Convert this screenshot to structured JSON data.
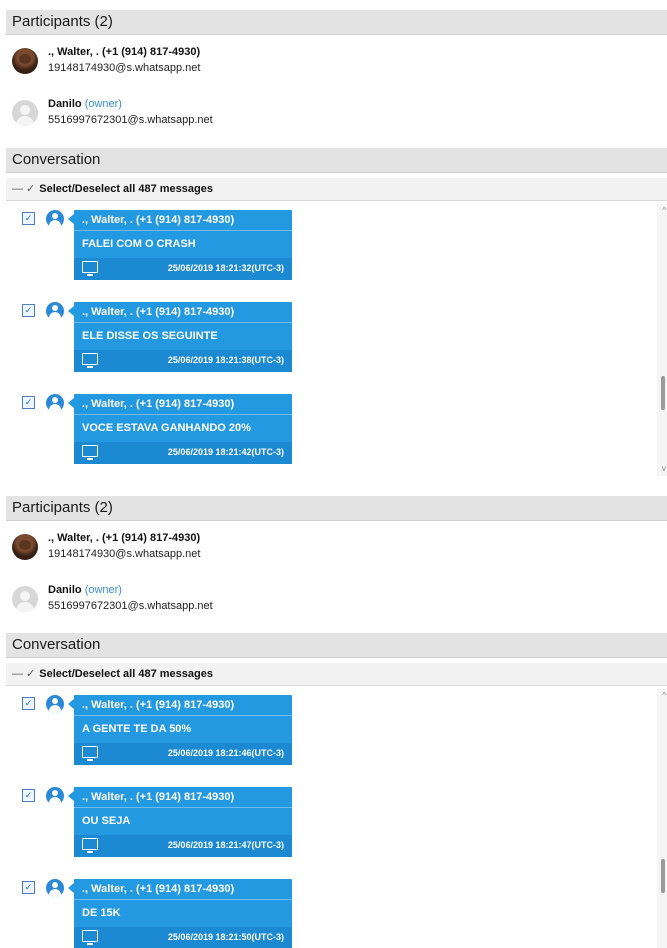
{
  "panels": [
    {
      "participants_header": "Participants (2)",
      "participants": [
        {
          "name": "., Walter, . (+1 (914) 817-4930)",
          "jid": "19148174930@s.whatsapp.net",
          "avatar_icon": "contact-photo"
        },
        {
          "name": "Danilo",
          "role": "(owner)",
          "jid": "5516997672301@s.whatsapp.net",
          "avatar_icon": "default-user-icon"
        }
      ],
      "conversation_header": "Conversation",
      "select_icons": "— ✓",
      "select_all_label": "Select/Deselect all 487 messages",
      "messages": [
        {
          "checked": "✓",
          "sender": "., Walter, . (+1 (914) 817-4930)",
          "text": "FALEI COM O CRASH",
          "timestamp": "25/06/2019 18:21:32(UTC-3)"
        },
        {
          "checked": "✓",
          "sender": "., Walter, . (+1 (914) 817-4930)",
          "text": "ELE DISSE OS SEGUINTE",
          "timestamp": "25/06/2019 18:21:38(UTC-3)"
        },
        {
          "checked": "✓",
          "sender": "., Walter, . (+1 (914) 817-4930)",
          "text": "VOCE ESTAVA GANHANDO 20%",
          "timestamp": "25/06/2019 18:21:42(UTC-3)"
        }
      ]
    },
    {
      "participants_header": "Participants (2)",
      "participants": [
        {
          "name": "., Walter, . (+1 (914) 817-4930)",
          "jid": "19148174930@s.whatsapp.net",
          "avatar_icon": "contact-photo"
        },
        {
          "name": "Danilo",
          "role": "(owner)",
          "jid": "5516997672301@s.whatsapp.net",
          "avatar_icon": "default-user-icon"
        }
      ],
      "conversation_header": "Conversation",
      "select_icons": "— ✓",
      "select_all_label": "Select/Deselect all 487 messages",
      "messages": [
        {
          "checked": "✓",
          "sender": "., Walter, . (+1 (914) 817-4930)",
          "text": "A GENTE TE DA 50%",
          "timestamp": "25/06/2019 18:21:46(UTC-3)"
        },
        {
          "checked": "✓",
          "sender": "., Walter, . (+1 (914) 817-4930)",
          "text": "OU SEJA",
          "timestamp": "25/06/2019 18:21:47(UTC-3)"
        },
        {
          "checked": "✓",
          "sender": "., Walter, . (+1 (914) 817-4930)",
          "text": "DE 15K",
          "timestamp": "25/06/2019 18:21:50(UTC-3)"
        }
      ]
    }
  ],
  "colors": {
    "bubble": "#2399e2",
    "bubble_footer": "#1c8ad3",
    "owner_link": "#3a8fd9",
    "header_bg": "#e3e3e3"
  }
}
